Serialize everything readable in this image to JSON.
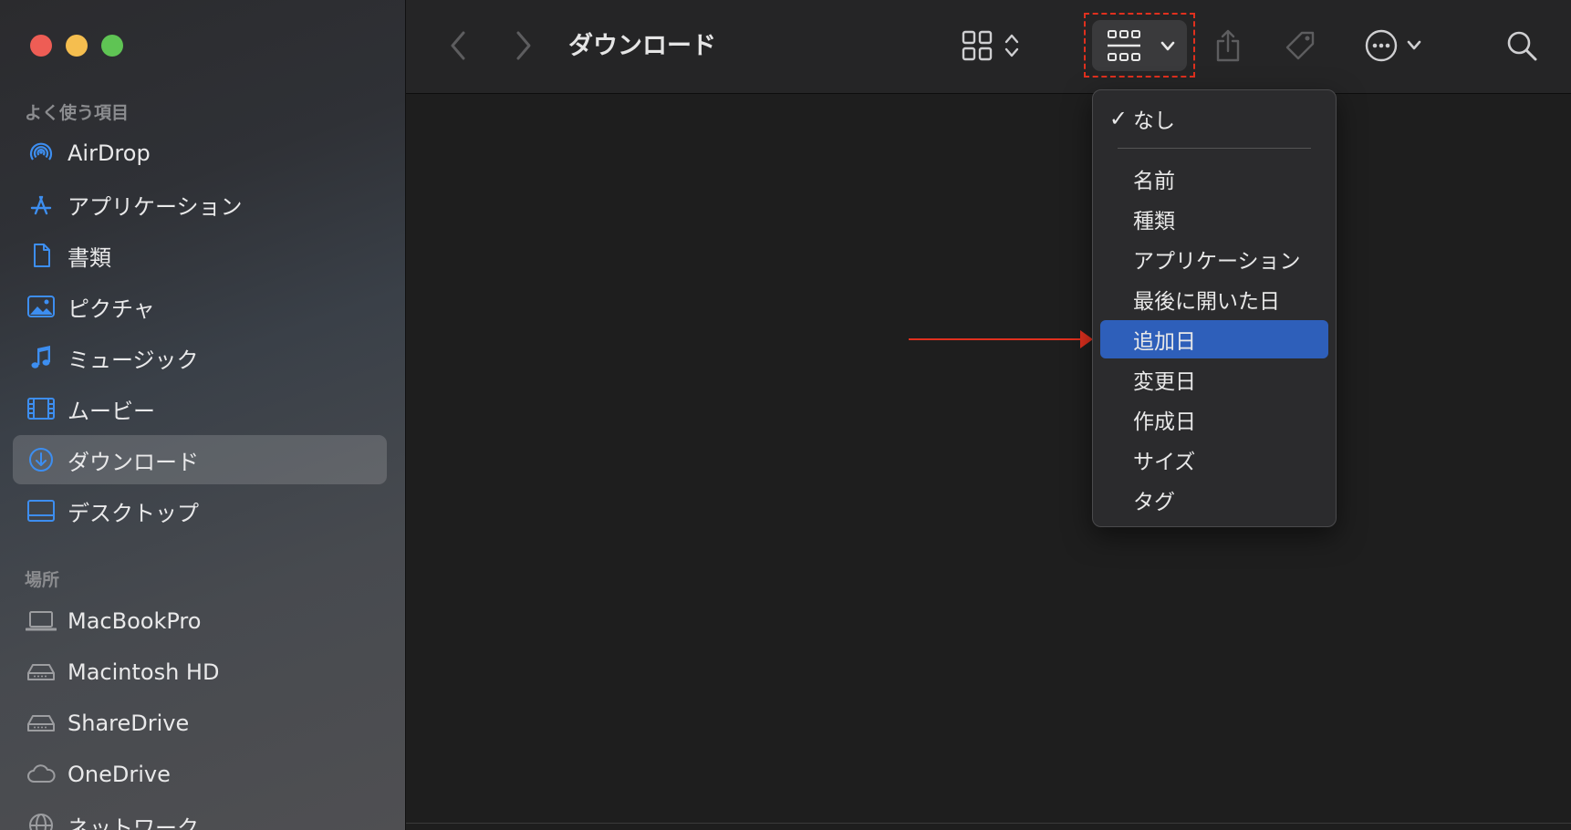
{
  "window": {
    "title": "ダウンロード"
  },
  "sidebar": {
    "favorites_title": "よく使う項目",
    "favorites": [
      {
        "label": "AirDrop",
        "icon": "airdrop-icon"
      },
      {
        "label": "アプリケーション",
        "icon": "applications-icon"
      },
      {
        "label": "書類",
        "icon": "document-icon"
      },
      {
        "label": "ピクチャ",
        "icon": "pictures-icon"
      },
      {
        "label": "ミュージック",
        "icon": "music-icon"
      },
      {
        "label": "ムービー",
        "icon": "movies-icon"
      },
      {
        "label": "ダウンロード",
        "icon": "downloads-icon",
        "selected": true
      },
      {
        "label": "デスクトップ",
        "icon": "desktop-icon"
      }
    ],
    "locations_title": "場所",
    "locations": [
      {
        "label": "MacBookPro",
        "icon": "laptop-icon"
      },
      {
        "label": "Macintosh HD",
        "icon": "drive-icon"
      },
      {
        "label": "ShareDrive",
        "icon": "drive-icon"
      },
      {
        "label": "OneDrive",
        "icon": "cloud-icon"
      },
      {
        "label": "ネットワーク",
        "icon": "network-icon"
      }
    ]
  },
  "group_menu": {
    "items": [
      {
        "label": "なし",
        "checked": true
      },
      {
        "label": "名前"
      },
      {
        "label": "種類"
      },
      {
        "label": "アプリケーション"
      },
      {
        "label": "最後に開いた日"
      },
      {
        "label": "追加日",
        "highlighted": true
      },
      {
        "label": "変更日"
      },
      {
        "label": "作成日"
      },
      {
        "label": "サイズ"
      },
      {
        "label": "タグ"
      }
    ],
    "check_glyph": "✓"
  },
  "colors": {
    "accent": "#2e5fba",
    "annotation": "#e0301e",
    "sidebar_icon": "#3d8ef0"
  }
}
